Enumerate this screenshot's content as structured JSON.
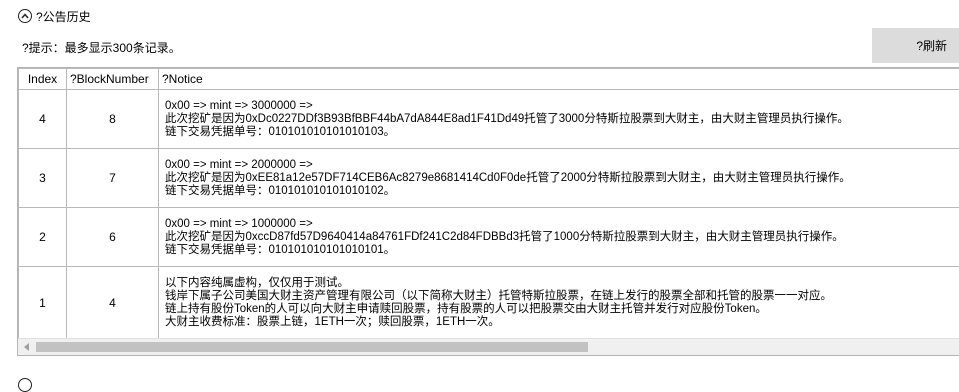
{
  "section": {
    "title": "?公告历史"
  },
  "hint": "?提示：最多显示300条记录。",
  "refresh_button": "?刷新",
  "table": {
    "columns": [
      "Index",
      "?BlockNumber",
      "?Notice"
    ],
    "rows": [
      {
        "index": "4",
        "block": "8",
        "notice": [
          "0x00 => mint  => 3000000 =>",
          "此次挖矿是因为0xDc0227DDf3B93BfBBF44bA7dA844E8ad1F41Dd49托管了3000分特斯拉股票到大财主，由大财主管理员执行操作。",
          "链下交易凭据单号：010101010101010103。"
        ]
      },
      {
        "index": "3",
        "block": "7",
        "notice": [
          "0x00 => mint  => 2000000 =>",
          "此次挖矿是因为0xEE81a12e57DF714CEB6Ac8279e8681414Cd0F0de托管了2000分特斯拉股票到大财主，由大财主管理员执行操作。",
          "链下交易凭据单号：010101010101010102。"
        ]
      },
      {
        "index": "2",
        "block": "6",
        "notice": [
          "0x00 => mint  => 1000000 =>",
          "此次挖矿是因为0xccD87fd57D9640414a84761FDf241C2d84FDBBd3托管了1000分特斯拉股票到大财主，由大财主管理员执行操作。",
          "链下交易凭据单号：010101010101010101。"
        ]
      },
      {
        "index": "1",
        "block": "4",
        "notice": [
          "以下内容纯属虚构，仅仅用于测试。",
          "钱岸下属子公司美国大财主资产管理有限公司（以下简称大财主）托管特斯拉股票，在链上发行的股票全部和托管的股票一一对应。",
          "链上持有股份Token的人可以向大财主申请赎回股票，持有股票的人可以把股票交由大财主托管并发行对应股份Token。",
          "大财主收费标准：股票上链，1ETH一次；赎回股票，1ETH一次。"
        ]
      }
    ]
  },
  "icons": {
    "collapse": "chevron-up-icon",
    "scroll_left": "triangle-left-icon"
  }
}
